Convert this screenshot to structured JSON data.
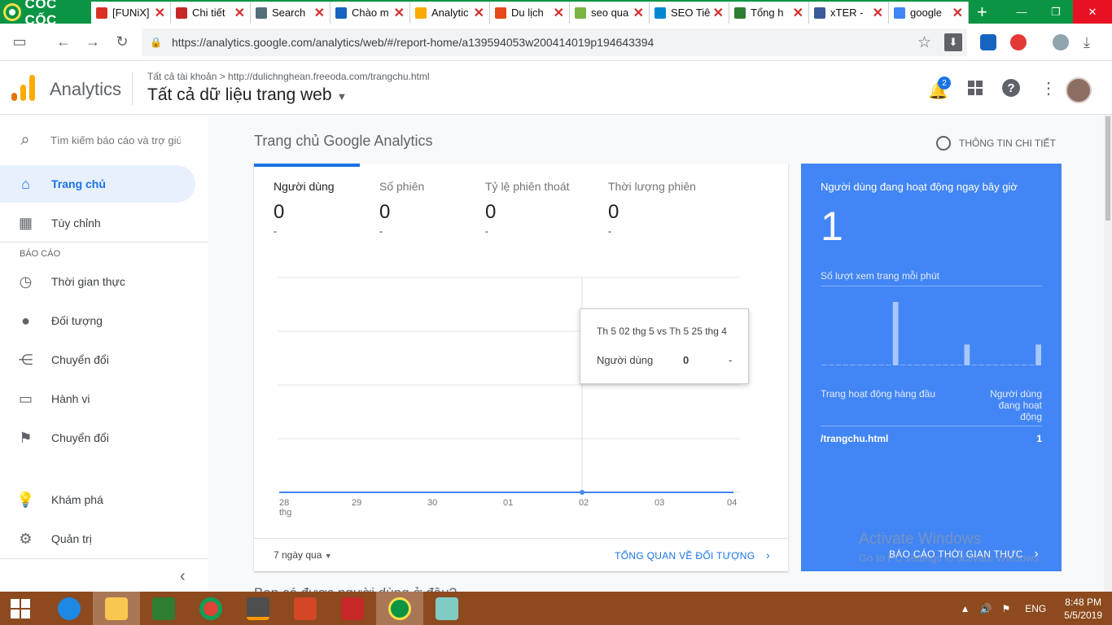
{
  "browser": {
    "brand": "CỐC CỐC",
    "tabs": [
      {
        "title": "[FUNiX]",
        "icon": "gmail-icon",
        "color": "#d93025"
      },
      {
        "title": "Chi tiết",
        "icon": "funix-icon",
        "color": "#c62828"
      },
      {
        "title": "Search",
        "icon": "page-icon",
        "color": "#546e7a"
      },
      {
        "title": "Chào m",
        "icon": "page-icon",
        "color": "#1565c0"
      },
      {
        "title": "Analytic",
        "icon": "analytics-icon",
        "color": "#f9ab00",
        "active": true
      },
      {
        "title": "Du lịch",
        "icon": "dulich-icon",
        "color": "#e64a19"
      },
      {
        "title": "seo qua",
        "icon": "leaf-icon",
        "color": "#7cb342"
      },
      {
        "title": "SEO Tiê",
        "icon": "seo-icon",
        "color": "#0288d1"
      },
      {
        "title": "Tổng h",
        "icon": "circle-icon",
        "color": "#2e7d32"
      },
      {
        "title": "xTER -",
        "icon": "facebook-icon",
        "color": "#3b5998"
      },
      {
        "title": "google",
        "icon": "google-icon",
        "color": "#4285f4"
      }
    ],
    "new_tab": "+",
    "url": "https://analytics.google.com/analytics/web/#/report-home/a139594053w200414019p194643394"
  },
  "header": {
    "app_name": "Analytics",
    "breadcrumb": "Tất cả tài khoản  >  http://dulichnghean.freeoda.com/trangchu.html",
    "view": "Tất cả dữ liệu trang web",
    "notifications": "2"
  },
  "sidebar": {
    "search_placeholder": "Tìm kiếm báo cáo và trợ giú",
    "items": [
      {
        "label": "Trang chủ",
        "icon": "home-icon"
      },
      {
        "label": "Tùy chỉnh",
        "icon": "customize-icon"
      }
    ],
    "section_label": "BÁO CÁO",
    "reports": [
      {
        "label": "Thời gian thực",
        "icon": "clock-icon"
      },
      {
        "label": "Đối tượng",
        "icon": "person-icon"
      },
      {
        "label": "Chuyển đổi",
        "icon": "acquisition-icon"
      },
      {
        "label": "Hành vi",
        "icon": "behavior-icon"
      },
      {
        "label": "Chuyển đổi",
        "icon": "flag-icon"
      }
    ],
    "bottom": [
      {
        "label": "Khám phá",
        "icon": "lightbulb-icon"
      },
      {
        "label": "Quản trị",
        "icon": "gear-icon"
      }
    ]
  },
  "main": {
    "page_title": "Trang chủ Google Analytics",
    "insights": "THÔNG TIN CHI TIẾT",
    "metrics": [
      {
        "label": "Người dùng",
        "value": "0",
        "delta": "-"
      },
      {
        "label": "Số phiên",
        "value": "0",
        "delta": "-"
      },
      {
        "label": "Tỷ lệ phiên thoát",
        "value": "0",
        "delta": "-"
      },
      {
        "label": "Thời lượng phiên",
        "value": "0",
        "delta": "-"
      }
    ],
    "tooltip": {
      "range": "Th 5 02 thg 5 vs Th 5 25 thg 4",
      "metric": "Người dùng",
      "value": "0",
      "delta": "-"
    },
    "date_range": "7 ngày qua",
    "overview_link": "TỔNG QUAN VỀ ĐỐI TƯỢNG",
    "below_title": "Bạn có được người dùng ở đâu?"
  },
  "chart_data": {
    "type": "line",
    "categories": [
      "28 thg",
      "29",
      "30",
      "01",
      "02",
      "03",
      "04"
    ],
    "series": [
      {
        "values": [
          0,
          0,
          0,
          0,
          0,
          0,
          0
        ]
      }
    ],
    "highlight_index": 4,
    "xlabel": "",
    "ylabel": "",
    "color": "#4285f4"
  },
  "realtime": {
    "title": "Người dùng đang hoạt động ngay bây giờ",
    "value": "1",
    "pageviews_label": "Số lượt xem trang mỗi phút",
    "bars": [
      0,
      0,
      0,
      0,
      0,
      0,
      0,
      0,
      0,
      0,
      1,
      0,
      0,
      0,
      0,
      0,
      0,
      0,
      0,
      0,
      0.33,
      0,
      0,
      0,
      0,
      0,
      0,
      0,
      0,
      0,
      0.33
    ],
    "col_page": "Trang hoạt động hàng đầu",
    "col_users": "Người dùng đang hoạt động",
    "top_page": "/trangchu.html",
    "top_page_users": "1",
    "link": "BÁO CÁO THỜI GIAN THỰC"
  },
  "watermark": {
    "line1": "Activate Windows",
    "line2": "Go to PC settings to activate Windows."
  },
  "taskbar": {
    "language": "ENG",
    "time": "8:48 PM",
    "date": "5/5/2019"
  },
  "colors": {
    "browser_green": "#0b9444",
    "accent": "#1a73e8",
    "realtime": "#4285f4",
    "taskbar": "#8c4a1e"
  }
}
